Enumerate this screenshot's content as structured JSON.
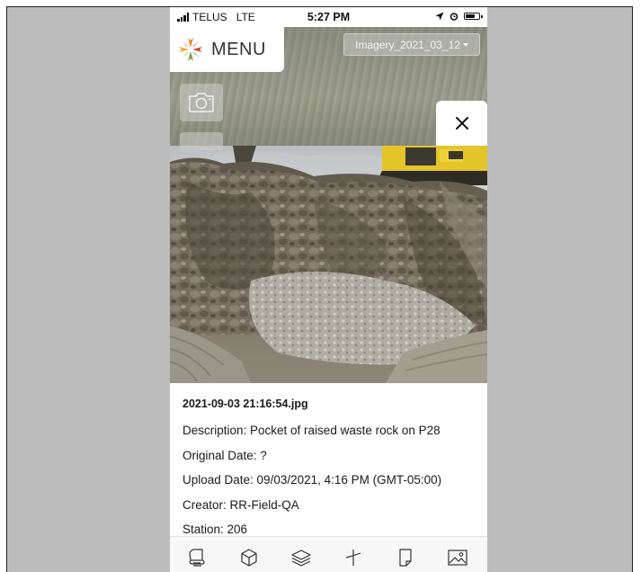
{
  "status_bar": {
    "carrier": "TELUS",
    "network": "LTE",
    "time": "5:27 PM",
    "battery_level": 0.8
  },
  "header": {
    "menu_label": "MENU",
    "imagery_selected": "Imagery_2021_03_12"
  },
  "photo_info": {
    "filename": "2021-09-03 21:16:54.jpg",
    "description": "Description: Pocket of raised waste rock on P28",
    "original_date": "Original Date: ?",
    "upload_date": "Upload Date: 09/03/2021, 4:16 PM (GMT-05:00)",
    "creator": "Creator: RR-Field-QA",
    "station": "Station: 206"
  },
  "toolbar": {
    "icons": [
      "bucket-icon",
      "cube-icon",
      "layers-icon",
      "measure-icon",
      "note-icon",
      "image-icon"
    ]
  },
  "colors": {
    "accent": "#e8832a",
    "map_overlay": "#959687",
    "toolbar_bg": "#f7f7f7"
  }
}
